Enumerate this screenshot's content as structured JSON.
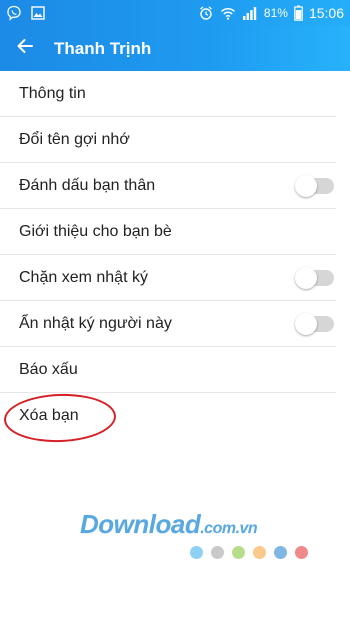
{
  "status_bar": {
    "left_icons": [
      "viber-icon",
      "gallery-icon"
    ],
    "right_icons": [
      "alarm-icon",
      "wifi-icon",
      "signal-icon",
      "battery-icon"
    ],
    "battery_percent": "81%",
    "time": "15:06"
  },
  "app_bar": {
    "back_icon": "arrow-left-icon",
    "title": "Thanh Trịnh"
  },
  "menu": {
    "items": [
      {
        "label": "Thông tin",
        "has_toggle": false
      },
      {
        "label": "Đổi tên gợi nhớ",
        "has_toggle": false
      },
      {
        "label": "Đánh dấu bạn thân",
        "has_toggle": true,
        "toggle_on": false
      },
      {
        "label": "Giới thiệu cho bạn bè",
        "has_toggle": false
      },
      {
        "label": "Chặn xem nhật ký",
        "has_toggle": true,
        "toggle_on": false
      },
      {
        "label": "Ẩn nhật ký người này",
        "has_toggle": true,
        "toggle_on": false
      },
      {
        "label": "Báo xấu",
        "has_toggle": false
      },
      {
        "label": "Xóa bạn",
        "has_toggle": false
      }
    ]
  },
  "annotation": {
    "highlighted_item": "Xóa bạn",
    "color": "#d61f26"
  },
  "watermark": {
    "text": "Download",
    "suffix": ".com.vn",
    "dot_colors": [
      "#8fd0f5",
      "#c9c9c9",
      "#b8dd8a",
      "#f7c98a",
      "#7fb6e3",
      "#f08a8a"
    ]
  },
  "colors": {
    "accent": "#1e9bf0",
    "toggle_off": "#d6d6d6"
  }
}
